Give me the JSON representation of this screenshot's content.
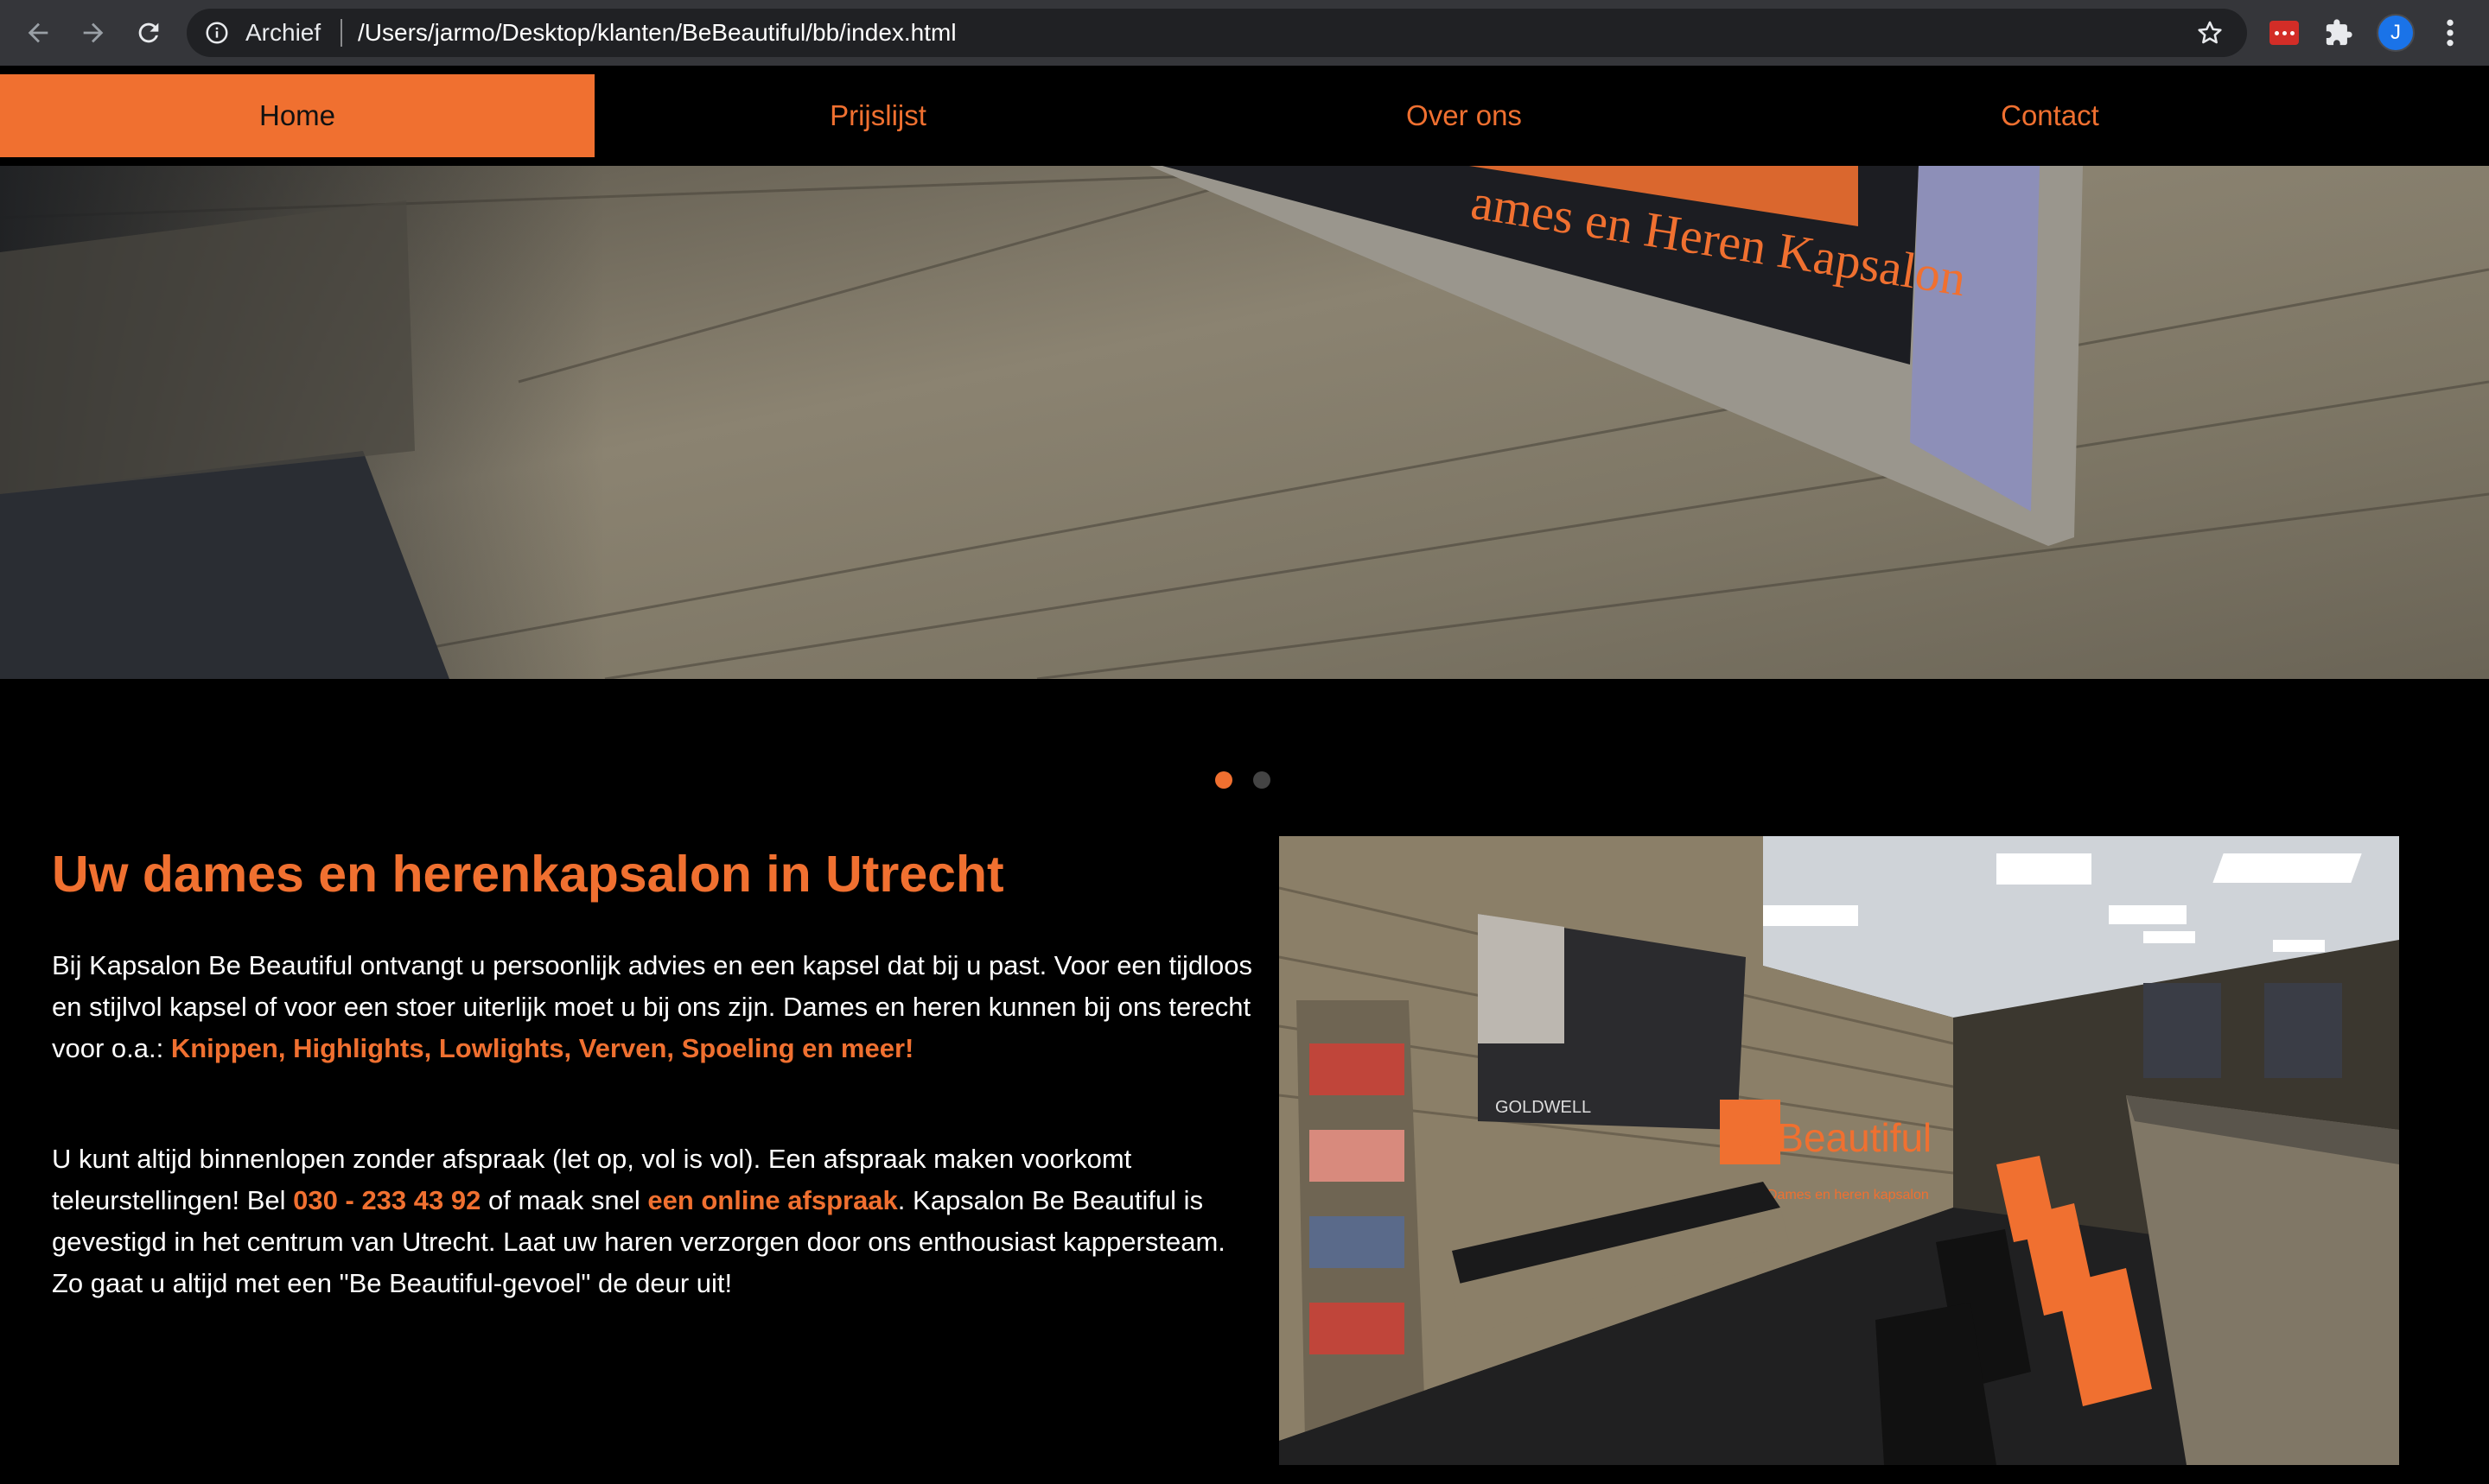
{
  "browser": {
    "site_label": "Archief",
    "url": "/Users/jarmo/Desktop/klanten/BeBeautiful/bb/index.html",
    "profile_initial": "J"
  },
  "nav": {
    "items": [
      {
        "label": "Home",
        "active": true
      },
      {
        "label": "Prijslijst",
        "active": false
      },
      {
        "label": "Over ons",
        "active": false
      },
      {
        "label": "Contact",
        "active": false
      }
    ]
  },
  "hero": {
    "sign_text": "ames en Heren Kapsalon",
    "slide_count": 2,
    "active_slide": 1
  },
  "main": {
    "title": "Uw dames en herenkapsalon in Utrecht",
    "p1_text": "Bij Kapsalon Be Beautiful ontvangt u persoonlijk advies en een kapsel dat bij u past. Voor een tijdloos en stijlvol kapsel of voor een stoer uiterlijk moet u bij ons zijn. Dames en heren kunnen bij ons terecht voor o.a.: ",
    "p1_highlight": "Knippen, Highlights, Lowlights, Verven, Spoeling en meer!",
    "p2_text_a": "U kunt altijd binnenlopen zonder afspraak (let op, vol is vol). Een afspraak maken voorkomt teleurstellingen! Bel ",
    "p2_phone": "030 - 233 43 92",
    "p2_text_b": " of maak snel ",
    "p2_link": "een online afspraak",
    "p2_text_c": ". Kapsalon Be Beautiful is gevestigd in het centrum van Utrecht. Laat uw haren verzorgen door ons enthousiast kappersteam. Zo gaat u altijd met een \"Be Beautiful-gevoel\" de deur uit!",
    "photo_logo": "BeBeautiful",
    "photo_tagline": "Dames en heren kapsalon",
    "photo_poster_text": "GOLDWELL"
  },
  "colors": {
    "accent": "#f07030",
    "background": "#000000",
    "text": "#ffffff"
  }
}
